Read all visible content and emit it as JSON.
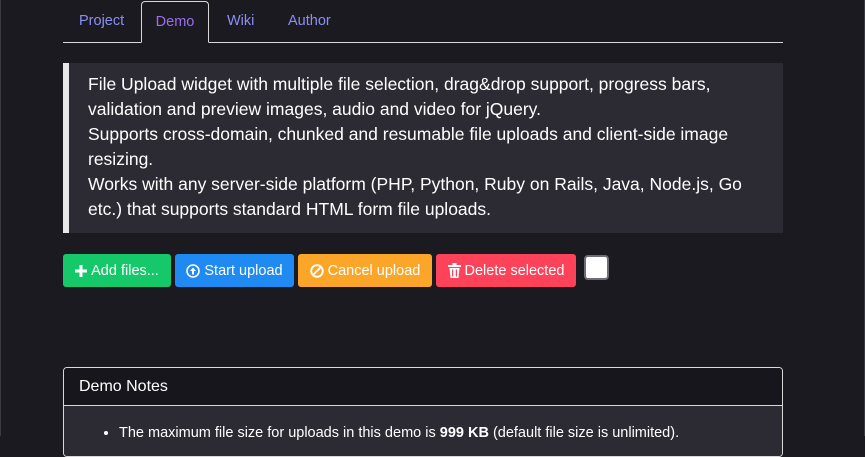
{
  "tabs": [
    {
      "label": "Project"
    },
    {
      "label": "Demo"
    },
    {
      "label": "Wiki"
    },
    {
      "label": "Author"
    }
  ],
  "active_tab": "Demo",
  "description": {
    "line1": "File Upload widget with multiple file selection, drag&drop support, progress bars, validation and preview images, audio and video for jQuery.",
    "line2": "Supports cross-domain, chunked and resumable file uploads and client-side image resizing.",
    "line3": "Works with any server-side platform (PHP, Python, Ruby on Rails, Java, Node.js, Go etc.) that supports standard HTML form file uploads."
  },
  "toolbar": {
    "add_label": "Add files...",
    "start_label": "Start upload",
    "cancel_label": "Cancel upload",
    "delete_label": "Delete selected"
  },
  "demo_notes": {
    "title": "Demo Notes",
    "note1_prefix": "The maximum file size for uploads in this demo is ",
    "note1_bold": "999 KB",
    "note1_suffix": " (default file size is unlimited)."
  },
  "colors": {
    "add": "#15c96a",
    "start": "#1f8bf2",
    "cancel": "#fba628",
    "delete": "#fd4259",
    "tab_link": "#8a8ff5",
    "tab_active": "#9c6cf2"
  }
}
